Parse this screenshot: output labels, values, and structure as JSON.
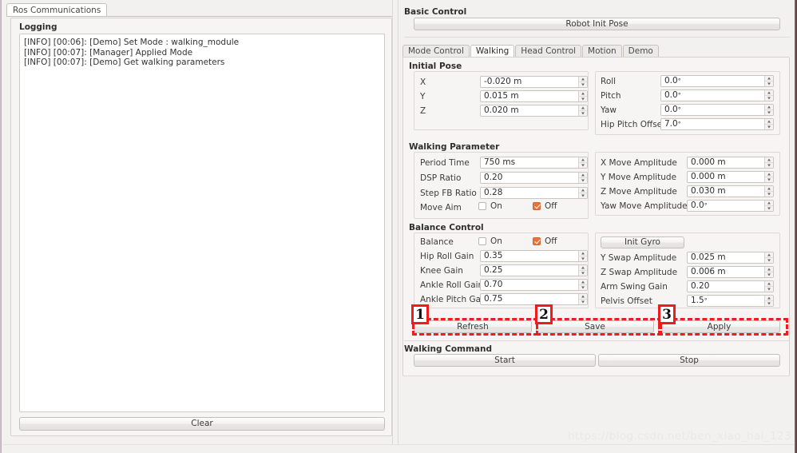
{
  "window": {
    "left_tab": "Ros Communications",
    "watermark": "https://blog.csdn.net/ben_xiao_hai_123"
  },
  "logging": {
    "title": "Logging",
    "lines": [
      "[INFO] [00:06]: [Demo] Set Mode : walking_module",
      "[INFO] [00:07]: [Manager] Applied Mode",
      "[INFO] [00:07]: [Demo] Get walking parameters"
    ],
    "clear_label": "Clear"
  },
  "basic_control": {
    "title": "Basic Control",
    "robot_init_pose_label": "Robot Init Pose"
  },
  "tabs": [
    {
      "label": "Mode Control",
      "active": false
    },
    {
      "label": "Walking",
      "active": true
    },
    {
      "label": "Head Control",
      "active": false
    },
    {
      "label": "Motion",
      "active": false
    },
    {
      "label": "Demo",
      "active": false
    }
  ],
  "initial_pose": {
    "title": "Initial Pose",
    "left_fields": [
      {
        "label": "X",
        "value": "-0.020 m"
      },
      {
        "label": "Y",
        "value": "0.015 m"
      },
      {
        "label": "Z",
        "value": "0.020 m"
      }
    ],
    "right_fields": [
      {
        "label": "Roll",
        "value": "0.0",
        "unit": "°"
      },
      {
        "label": "Pitch",
        "value": "0.0",
        "unit": "°"
      },
      {
        "label": "Yaw",
        "value": "0.0",
        "unit": "°"
      },
      {
        "label": "Hip Pitch Offset",
        "value": "7.0",
        "unit": "°"
      }
    ]
  },
  "walking_parameter": {
    "title": "Walking Parameter",
    "left_fields": [
      {
        "label": "Period Time",
        "value": "750 ms"
      },
      {
        "label": "DSP Ratio",
        "value": "0.20"
      },
      {
        "label": "Step FB Ratio",
        "value": "0.28"
      }
    ],
    "move_aim": {
      "label": "Move Aim",
      "on_label": "On",
      "off_label": "Off",
      "on_checked": false,
      "off_checked": true
    },
    "right_fields": [
      {
        "label": "X Move Amplitude",
        "value": "0.000 m"
      },
      {
        "label": "Y Move Amplitude",
        "value": "0.000 m"
      },
      {
        "label": "Z Move Amplitude",
        "value": "0.030 m"
      },
      {
        "label": "Yaw Move Amplitude",
        "value": "0.0",
        "unit": "°"
      }
    ]
  },
  "balance_control": {
    "title": "Balance Control",
    "balance": {
      "label": "Balance",
      "on_label": "On",
      "off_label": "Off",
      "on_checked": false,
      "off_checked": true
    },
    "left_fields": [
      {
        "label": "Hip Roll Gain",
        "value": "0.35"
      },
      {
        "label": "Knee Gain",
        "value": "0.25"
      },
      {
        "label": "Ankle Roll Gain",
        "value": "0.70"
      },
      {
        "label": "Ankle Pitch Gain",
        "value": "0.75"
      }
    ],
    "init_gyro_label": "Init Gyro",
    "right_fields": [
      {
        "label": "Y Swap Amplitude",
        "value": "0.025 m"
      },
      {
        "label": "Z Swap Amplitude",
        "value": "0.006 m"
      },
      {
        "label": "Arm Swing Gain",
        "value": "0.20"
      },
      {
        "label": "Pelvis Offset",
        "value": "1.5",
        "unit": "°"
      }
    ]
  },
  "action_buttons": {
    "refresh_label": "Refresh",
    "save_label": "Save",
    "apply_label": "Apply"
  },
  "walking_command": {
    "title": "Walking Command",
    "start_label": "Start",
    "stop_label": "Stop"
  },
  "annotations": {
    "accent_color": "#ee1c1c",
    "markers": [
      {
        "number": "1",
        "target": "Refresh"
      },
      {
        "number": "2",
        "target": "Save"
      },
      {
        "number": "3",
        "target": "Apply"
      }
    ]
  }
}
